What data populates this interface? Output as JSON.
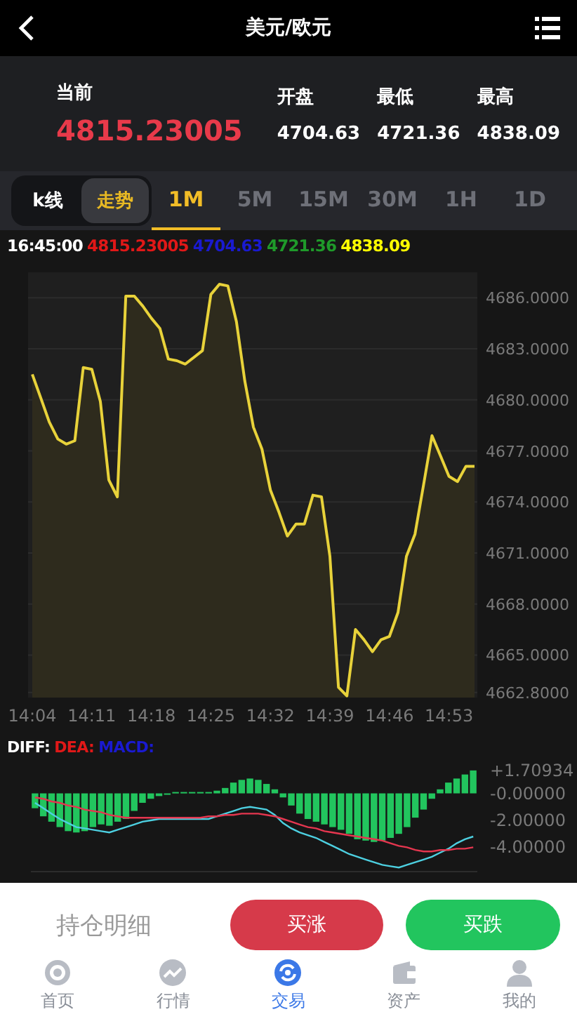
{
  "header": {
    "title": "美元/欧元"
  },
  "quote": {
    "current_label": "当前",
    "current": "4815.23005",
    "stats": [
      {
        "label": "开盘",
        "value": "4704.63"
      },
      {
        "label": "最低",
        "value": "4721.36"
      },
      {
        "label": "最高",
        "value": "4838.09"
      }
    ]
  },
  "mode_tabs": [
    {
      "label": "k线",
      "selected": false
    },
    {
      "label": "走势",
      "selected": true
    }
  ],
  "interval_tabs": [
    {
      "label": "1M",
      "selected": true
    },
    {
      "label": "5M",
      "selected": false
    },
    {
      "label": "15M",
      "selected": false
    },
    {
      "label": "30M",
      "selected": false
    },
    {
      "label": "1H",
      "selected": false
    },
    {
      "label": "1D",
      "selected": false
    }
  ],
  "legend": [
    {
      "text": "16:45:00",
      "color": "#ffffff"
    },
    {
      "text": "4815.23005",
      "color": "#e01818"
    },
    {
      "text": "4704.63",
      "color": "#1a1ad0"
    },
    {
      "text": "4721.36",
      "color": "#1f9a2a"
    },
    {
      "text": "4838.09",
      "color": "#ffff00"
    }
  ],
  "price_chart": {
    "chart_data": {
      "type": "area",
      "categories": [
        "14:04",
        null,
        null,
        null,
        null,
        null,
        null,
        "14:11",
        null,
        null,
        null,
        null,
        null,
        null,
        "14:18",
        null,
        null,
        null,
        null,
        null,
        null,
        "14:25",
        null,
        null,
        null,
        null,
        null,
        null,
        "14:32",
        null,
        null,
        null,
        null,
        null,
        null,
        "14:39",
        null,
        null,
        null,
        null,
        null,
        null,
        "14:46",
        null,
        null,
        null,
        null,
        null,
        null,
        "14:53",
        null,
        null,
        null
      ],
      "series": [
        {
          "color": "#e8d23a",
          "values": [
            4681.5,
            4680.1,
            4678.7,
            4677.7,
            4677.4,
            4677.6,
            4681.9,
            4681.8,
            4679.9,
            4675.3,
            4674.3,
            4686.1,
            4686.1,
            4685.5,
            4684.8,
            4684.2,
            4682.4,
            4682.3,
            4682.1,
            4682.5,
            4682.9,
            4686.2,
            4686.8,
            4686.7,
            4684.6,
            4681.1,
            4678.4,
            4677.1,
            4674.7,
            4673.4,
            4672.0,
            4672.7,
            4672.7,
            4674.4,
            4674.3,
            4670.8,
            4663.1,
            4662.6,
            4666.5,
            4665.9,
            4665.2,
            4665.9,
            4666.1,
            4667.5,
            4670.8,
            4672.1,
            4675.0,
            4677.9,
            4676.7,
            4675.5,
            4675.2,
            4676.1,
            4676.1
          ]
        }
      ],
      "ylim": [
        4662.5,
        4687.5
      ],
      "grid": true,
      "yticks": [
        {
          "value": 4686,
          "label": "4686.0000"
        },
        {
          "value": 4683,
          "label": "4683.0000"
        },
        {
          "value": 4680,
          "label": "4680.0000"
        },
        {
          "value": 4677,
          "label": "4677.0000"
        },
        {
          "value": 4674,
          "label": "4674.0000"
        },
        {
          "value": 4671,
          "label": "4671.0000"
        },
        {
          "value": 4668,
          "label": "4668.0000"
        },
        {
          "value": 4665,
          "label": "4665.0000"
        },
        {
          "value": 4662.8,
          "label": "4662.8000"
        }
      ]
    }
  },
  "macd_legend": [
    {
      "text": "DIFF:",
      "color": "#ffffff"
    },
    {
      "text": "DEA:",
      "color": "#e01818"
    },
    {
      "text": "MACD:",
      "color": "#1a1ad0"
    }
  ],
  "macd_chart": {
    "chart_data": {
      "type": "bar",
      "ylim": [
        -5.8,
        1.9
      ],
      "yticks": [
        {
          "value": 1.70934,
          "label": "+1.70934"
        },
        {
          "value": 0,
          "label": "-0.00000"
        },
        {
          "value": -2,
          "label": "-2.00000"
        },
        {
          "value": -4,
          "label": "-4.00000"
        }
      ],
      "series": [
        {
          "color": "#22c55e",
          "values": [
            -1.1,
            -1.7,
            -2.1,
            -2.5,
            -2.8,
            -2.9,
            -2.8,
            -2.5,
            -2.3,
            -2.4,
            -2.1,
            -1.9,
            -1.3,
            -0.7,
            -0.4,
            -0.2,
            -0.1,
            0.1,
            0.1,
            0.1,
            0.1,
            0.1,
            0.2,
            0.4,
            0.8,
            1.0,
            1.1,
            1.0,
            0.7,
            0.3,
            -0.3,
            -0.9,
            -1.5,
            -1.9,
            -2.1,
            -2.3,
            -2.5,
            -2.7,
            -3.0,
            -3.4,
            -3.5,
            -3.6,
            -3.5,
            -3.3,
            -3.0,
            -2.5,
            -1.8,
            -1.2,
            -0.4,
            0.3,
            0.8,
            1.1,
            1.4,
            1.7
          ]
        },
        {
          "type": "line",
          "color": "#4dd0e1",
          "values": [
            -0.7,
            -1.1,
            -1.5,
            -1.9,
            -2.2,
            -2.5,
            -2.6,
            -2.7,
            -2.8,
            -2.9,
            -2.7,
            -2.5,
            -2.3,
            -2.1,
            -2.0,
            -1.9,
            -1.9,
            -1.9,
            -1.9,
            -1.9,
            -1.9,
            -1.9,
            -1.7,
            -1.5,
            -1.3,
            -1.1,
            -1.0,
            -1.1,
            -1.2,
            -1.6,
            -2.2,
            -2.6,
            -2.9,
            -3.1,
            -3.3,
            -3.6,
            -3.9,
            -4.2,
            -4.5,
            -4.7,
            -4.9,
            -5.1,
            -5.3,
            -5.4,
            -5.5,
            -5.3,
            -5.1,
            -4.9,
            -4.7,
            -4.4,
            -4.1,
            -3.7,
            -3.4,
            -3.2
          ]
        },
        {
          "type": "line",
          "color": "#e5364f",
          "values": [
            -0.3,
            -0.4,
            -0.6,
            -0.7,
            -0.9,
            -1.0,
            -1.2,
            -1.3,
            -1.4,
            -1.6,
            -1.7,
            -1.8,
            -1.8,
            -1.8,
            -1.8,
            -1.8,
            -1.8,
            -1.8,
            -1.8,
            -1.8,
            -1.8,
            -1.7,
            -1.7,
            -1.6,
            -1.6,
            -1.5,
            -1.5,
            -1.5,
            -1.6,
            -1.7,
            -1.9,
            -2.1,
            -2.3,
            -2.5,
            -2.6,
            -2.8,
            -2.9,
            -3.0,
            -3.1,
            -3.2,
            -3.3,
            -3.4,
            -3.5,
            -3.7,
            -3.9,
            -4.0,
            -4.2,
            -4.3,
            -4.3,
            -4.2,
            -4.2,
            -4.1,
            -4.1,
            -4.0
          ]
        }
      ]
    }
  },
  "actions": {
    "positions_label": "持仓明细",
    "buttons": [
      {
        "label": "买涨",
        "color": "#d63a4a"
      },
      {
        "label": "买跌",
        "color": "#22c55e"
      }
    ]
  },
  "nav": [
    {
      "label": "首页",
      "selected": false
    },
    {
      "label": "行情",
      "selected": false
    },
    {
      "label": "交易",
      "selected": true
    },
    {
      "label": "资产",
      "selected": false
    },
    {
      "label": "我的",
      "selected": false
    }
  ]
}
